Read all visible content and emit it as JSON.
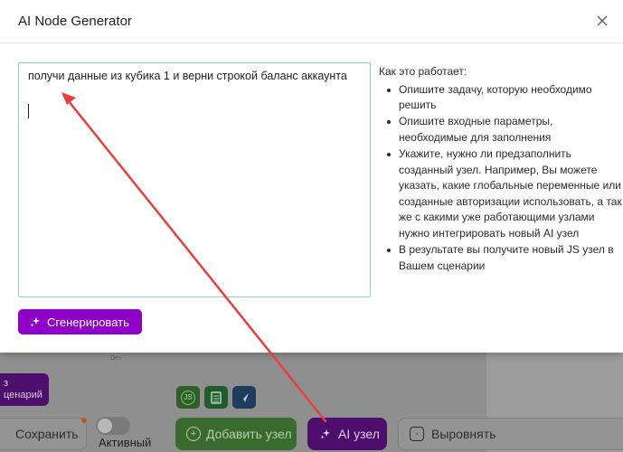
{
  "modal": {
    "title": "AI Node Generator",
    "prompt_value": "получи данные из кубика 1 и верни строкой баланс аккаунта",
    "generate_label": "Сгенерировать",
    "help": {
      "heading": "Как это работает:",
      "items": [
        "Опишите задачу, которую необходимо решить",
        "Опишите входные параметры, необходимые для заполнения",
        "Укажите, нужно ли предзаполнить созданный узел. Например, Вы можете указать, какие глобальные переменные или созданные авторизации использовать, а так же с какими уже работающими узлами нужно интегрировать новый AI узел",
        "В результате вы получите новый JS узел в Вашем сценарии"
      ]
    }
  },
  "background": {
    "dev_label": "Dev",
    "node_text": "з\nценарий",
    "quick_nodes": [
      "JS",
      "sheet",
      "plane"
    ],
    "toolbar": {
      "save_label": "Сохранить",
      "active_label": "Активный",
      "add_node_label": "Добавить узел",
      "ai_node_label": "AI узел",
      "align_label": "Выровнять"
    }
  },
  "colors": {
    "accent": "#8e00c5",
    "annotation_arrow": "#e8403f",
    "focus_border": "#8cc7ef"
  }
}
